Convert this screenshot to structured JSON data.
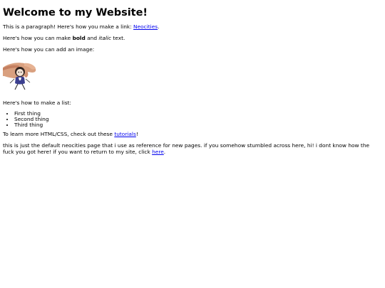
{
  "page": {
    "heading": "Welcome to my Website!",
    "intro_text": "This is a paragraph! Here's how you make a link: ",
    "intro_link": "Neocities",
    "intro_end": ".",
    "bold_prefix": "Here's how you can make ",
    "bold_word": "bold",
    "bold_middle": " and ",
    "italic_word": "italic",
    "bold_suffix": " text.",
    "image_text": "Here's how you can add an image:",
    "image_icon": "hand-holding-figure-image",
    "list_text": "Here's how to make a list:",
    "list_items": [
      "First thing",
      "Second thing",
      "Third thing"
    ],
    "learn_prefix": "To learn more HTML/CSS, check out these ",
    "learn_link": "tutorials",
    "learn_suffix": "!",
    "note_text": "this is just the default neocities page that i use as reference for new pages. if you somehow stumbled across here, hi! i dont know how the fuck you got here! if you want to return to my site, click ",
    "note_link": "here",
    "note_end": "."
  },
  "colors": {
    "link": "#0000ee",
    "text": "#000000",
    "background": "#ffffff"
  }
}
